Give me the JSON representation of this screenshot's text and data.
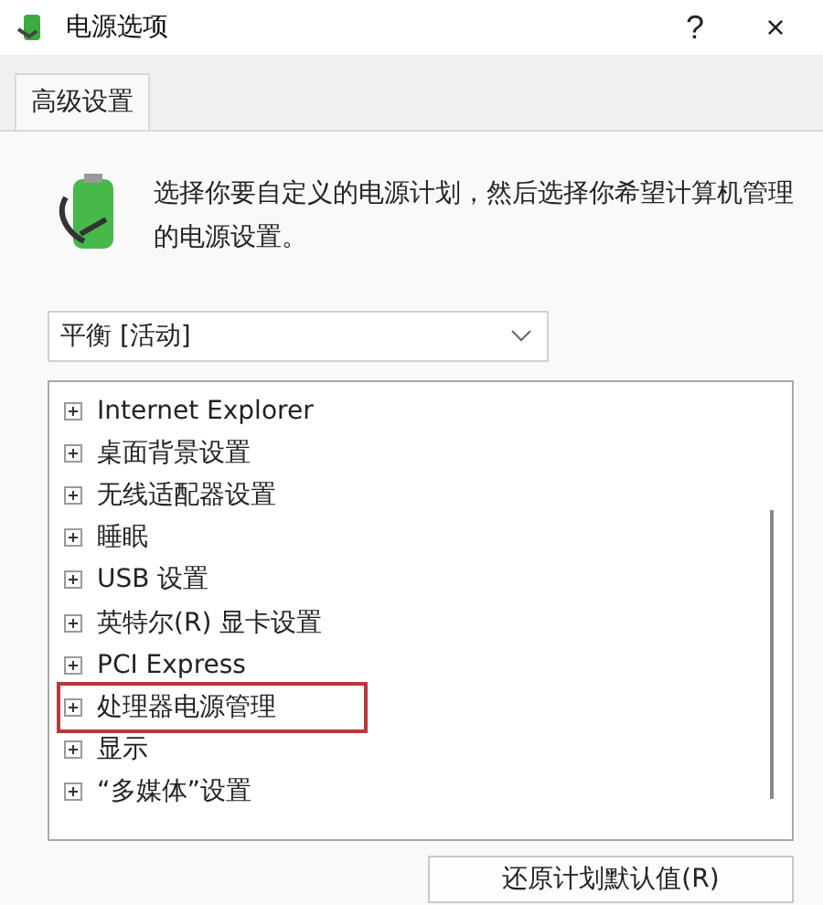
{
  "window": {
    "title": "电源选项",
    "help": "?",
    "close": "×"
  },
  "tabs": [
    {
      "label": "高级设置",
      "selected": true
    }
  ],
  "description": "选择你要自定义的电源计划，然后选择你希望计算机管理的电源设置。",
  "plan_select": {
    "value": "平衡 [活动]"
  },
  "settings_tree": [
    {
      "label": "Internet Explorer",
      "expanded": false,
      "highlighted": false
    },
    {
      "label": "桌面背景设置",
      "expanded": false,
      "highlighted": false
    },
    {
      "label": "无线适配器设置",
      "expanded": false,
      "highlighted": false
    },
    {
      "label": "睡眠",
      "expanded": false,
      "highlighted": false
    },
    {
      "label": "USB 设置",
      "expanded": false,
      "highlighted": false
    },
    {
      "label": "英特尔(R) 显卡设置",
      "expanded": false,
      "highlighted": false
    },
    {
      "label": "PCI Express",
      "expanded": false,
      "highlighted": false
    },
    {
      "label": "处理器电源管理",
      "expanded": false,
      "highlighted": true
    },
    {
      "label": "显示",
      "expanded": false,
      "highlighted": false
    },
    {
      "label": "“多媒体”设置",
      "expanded": false,
      "highlighted": false
    }
  ],
  "buttons": [
    {
      "label": "还原计划默认值(R)"
    }
  ]
}
